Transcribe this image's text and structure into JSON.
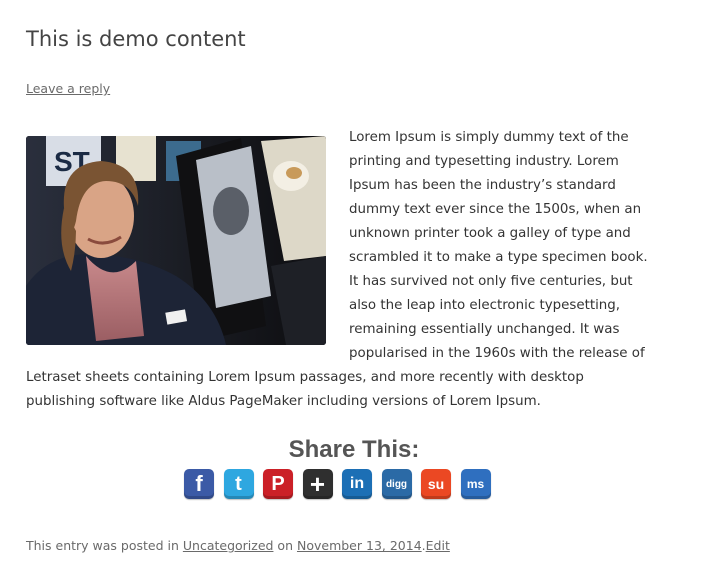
{
  "post": {
    "title": "This is demo content",
    "reply_link": "Leave a reply",
    "body_text": "Lorem Ipsum is simply dummy text of the printing and typesetting industry. Lorem Ipsum has been the industry’s standard dummy text ever since the 1500s, when an unknown printer took a galley of type and scrambled it to make a type specimen book. It has survived not only five centuries, but also the leap into electronic typesetting, remaining essentially unchanged. It was popularised in the 1960s with the release of Letraset sheets containing Lorem Ipsum passages, and more recently with desktop publishing software like Aldus PageMaker including versions of Lorem Ipsum.",
    "image_description": "photo-of-smiling-man"
  },
  "share": {
    "title": "Share This:",
    "buttons": [
      {
        "icon": "facebook-icon",
        "glyph": "f",
        "color": "#3b5aa6"
      },
      {
        "icon": "twitter-icon",
        "glyph": "t",
        "color": "#2ea7e0"
      },
      {
        "icon": "pinterest-icon",
        "glyph": "P",
        "color": "#cb2027"
      },
      {
        "icon": "plus-icon",
        "glyph": "+",
        "color": "#2f2f2f"
      },
      {
        "icon": "linkedin-icon",
        "glyph": "in",
        "color": "#1c6fb5"
      },
      {
        "icon": "digg-icon",
        "glyph": "digg",
        "color": "#2b6aa6"
      },
      {
        "icon": "stumbleupon-icon",
        "glyph": "su",
        "color": "#eb4823"
      },
      {
        "icon": "myspace-icon",
        "glyph": "ms",
        "color": "#2f6fbf"
      }
    ]
  },
  "footer": {
    "prefix": "This entry was posted in ",
    "category": "Uncategorized",
    "on": " on ",
    "date": "November 13, 2014",
    "separator": ".",
    "edit": "Edit"
  }
}
